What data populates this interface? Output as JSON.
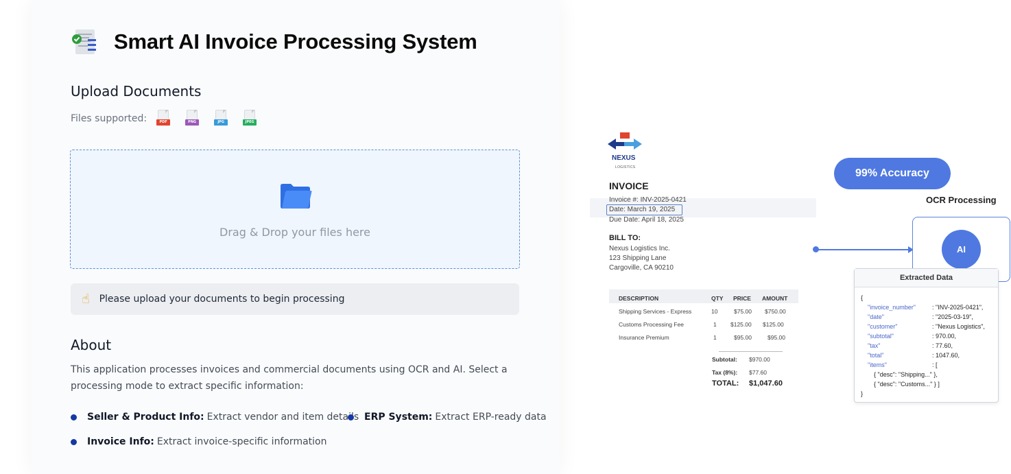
{
  "app": {
    "title": "Smart AI Invoice Processing System"
  },
  "upload": {
    "heading": "Upload Documents",
    "files_label": "Files supported:",
    "file_types": [
      {
        "label": "PDF",
        "color": "#e0452f"
      },
      {
        "label": "PNG",
        "color": "#9b59b6"
      },
      {
        "label": "JPG",
        "color": "#3a9ad9"
      },
      {
        "label": "JPEG",
        "color": "#27ae60"
      }
    ],
    "dropzone_text": "Drag & Drop your files here",
    "notice_icon": "pointing-hand-icon",
    "notice_text": "Please upload your documents to begin processing"
  },
  "about": {
    "heading": "About",
    "description": "This application processes invoices and commercial documents using OCR and AI. Select a processing mode to extract specific information:",
    "modes": [
      {
        "title": "Seller & Product Info:",
        "desc": "Extract vendor and item details"
      },
      {
        "title": "ERP System:",
        "desc": "Extract ERP-ready data"
      },
      {
        "title": "Invoice Info:",
        "desc": "Extract invoice-specific information"
      }
    ]
  },
  "illustration": {
    "company": "NEXUS",
    "company_sub": "LOGISTICS",
    "invoice_title": "INVOICE",
    "invoice_number": "Invoice #: INV-2025-0421",
    "date": "Date: March 19, 2025",
    "due_date": "Due Date: April 18, 2025",
    "bill_to_label": "BILL TO:",
    "bill_to": [
      "Nexus Logistics Inc.",
      "123 Shipping Lane",
      "Cargoville, CA 90210"
    ],
    "table_headers": [
      "DESCRIPTION",
      "QTY",
      "PRICE",
      "AMOUNT"
    ],
    "rows": [
      [
        "Shipping Services - Express",
        "10",
        "$75.00",
        "$750.00"
      ],
      [
        "Customs Processing Fee",
        "1",
        "$125.00",
        "$125.00"
      ],
      [
        "Insurance Premium",
        "1",
        "$95.00",
        "$95.00"
      ]
    ],
    "subtotal_label": "Subtotal:",
    "subtotal": "$970.00",
    "tax_label": "Tax (8%):",
    "tax": "$77.60",
    "total_label": "TOTAL:",
    "total": "$1,047.60",
    "accuracy": "99% Accuracy",
    "ocr_label": "OCR Processing",
    "ai_label": "AI",
    "extracted_title": "Extracted Data",
    "json_lines": [
      {
        "key": "",
        "val": "{"
      },
      {
        "key": "\"invoice_number\"",
        "val": ":  \"INV-2025-0421\","
      },
      {
        "key": "\"date\"",
        "val": ":  \"2025-03-19\","
      },
      {
        "key": "\"customer\"",
        "val": ":  \"Nexus Logistics\","
      },
      {
        "key": "\"subtotal\"",
        "val": ":  970.00,"
      },
      {
        "key": "\"tax\"",
        "val": ":  77.60,"
      },
      {
        "key": "\"total\"",
        "val": ":  1047.60,"
      },
      {
        "key": "\"items\"",
        "val": ":  ["
      },
      {
        "key": "",
        "val": "{ \"desc\": \"Shipping...\" },"
      },
      {
        "key": "",
        "val": "{ \"desc\": \"Customs...\" }        ]"
      },
      {
        "key": "",
        "val": "}"
      }
    ],
    "accent_color": "#4f79e0"
  }
}
